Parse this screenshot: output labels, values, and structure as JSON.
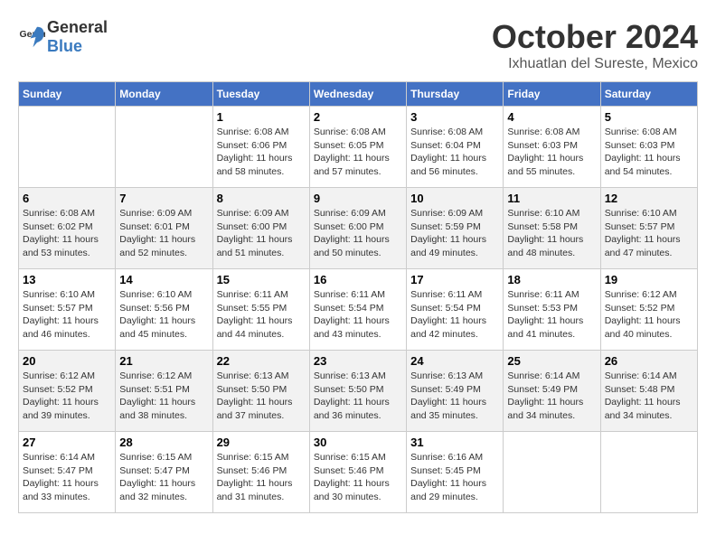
{
  "header": {
    "logo_general": "General",
    "logo_blue": "Blue",
    "month": "October 2024",
    "location": "Ixhuatlan del Sureste, Mexico"
  },
  "days_of_week": [
    "Sunday",
    "Monday",
    "Tuesday",
    "Wednesday",
    "Thursday",
    "Friday",
    "Saturday"
  ],
  "weeks": [
    [
      {
        "day": "",
        "info": ""
      },
      {
        "day": "",
        "info": ""
      },
      {
        "day": "1",
        "sunrise": "6:08 AM",
        "sunset": "6:06 PM",
        "daylight": "11 hours and 58 minutes."
      },
      {
        "day": "2",
        "sunrise": "6:08 AM",
        "sunset": "6:05 PM",
        "daylight": "11 hours and 57 minutes."
      },
      {
        "day": "3",
        "sunrise": "6:08 AM",
        "sunset": "6:04 PM",
        "daylight": "11 hours and 56 minutes."
      },
      {
        "day": "4",
        "sunrise": "6:08 AM",
        "sunset": "6:03 PM",
        "daylight": "11 hours and 55 minutes."
      },
      {
        "day": "5",
        "sunrise": "6:08 AM",
        "sunset": "6:03 PM",
        "daylight": "11 hours and 54 minutes."
      }
    ],
    [
      {
        "day": "6",
        "sunrise": "6:08 AM",
        "sunset": "6:02 PM",
        "daylight": "11 hours and 53 minutes."
      },
      {
        "day": "7",
        "sunrise": "6:09 AM",
        "sunset": "6:01 PM",
        "daylight": "11 hours and 52 minutes."
      },
      {
        "day": "8",
        "sunrise": "6:09 AM",
        "sunset": "6:00 PM",
        "daylight": "11 hours and 51 minutes."
      },
      {
        "day": "9",
        "sunrise": "6:09 AM",
        "sunset": "6:00 PM",
        "daylight": "11 hours and 50 minutes."
      },
      {
        "day": "10",
        "sunrise": "6:09 AM",
        "sunset": "5:59 PM",
        "daylight": "11 hours and 49 minutes."
      },
      {
        "day": "11",
        "sunrise": "6:10 AM",
        "sunset": "5:58 PM",
        "daylight": "11 hours and 48 minutes."
      },
      {
        "day": "12",
        "sunrise": "6:10 AM",
        "sunset": "5:57 PM",
        "daylight": "11 hours and 47 minutes."
      }
    ],
    [
      {
        "day": "13",
        "sunrise": "6:10 AM",
        "sunset": "5:57 PM",
        "daylight": "11 hours and 46 minutes."
      },
      {
        "day": "14",
        "sunrise": "6:10 AM",
        "sunset": "5:56 PM",
        "daylight": "11 hours and 45 minutes."
      },
      {
        "day": "15",
        "sunrise": "6:11 AM",
        "sunset": "5:55 PM",
        "daylight": "11 hours and 44 minutes."
      },
      {
        "day": "16",
        "sunrise": "6:11 AM",
        "sunset": "5:54 PM",
        "daylight": "11 hours and 43 minutes."
      },
      {
        "day": "17",
        "sunrise": "6:11 AM",
        "sunset": "5:54 PM",
        "daylight": "11 hours and 42 minutes."
      },
      {
        "day": "18",
        "sunrise": "6:11 AM",
        "sunset": "5:53 PM",
        "daylight": "11 hours and 41 minutes."
      },
      {
        "day": "19",
        "sunrise": "6:12 AM",
        "sunset": "5:52 PM",
        "daylight": "11 hours and 40 minutes."
      }
    ],
    [
      {
        "day": "20",
        "sunrise": "6:12 AM",
        "sunset": "5:52 PM",
        "daylight": "11 hours and 39 minutes."
      },
      {
        "day": "21",
        "sunrise": "6:12 AM",
        "sunset": "5:51 PM",
        "daylight": "11 hours and 38 minutes."
      },
      {
        "day": "22",
        "sunrise": "6:13 AM",
        "sunset": "5:50 PM",
        "daylight": "11 hours and 37 minutes."
      },
      {
        "day": "23",
        "sunrise": "6:13 AM",
        "sunset": "5:50 PM",
        "daylight": "11 hours and 36 minutes."
      },
      {
        "day": "24",
        "sunrise": "6:13 AM",
        "sunset": "5:49 PM",
        "daylight": "11 hours and 35 minutes."
      },
      {
        "day": "25",
        "sunrise": "6:14 AM",
        "sunset": "5:49 PM",
        "daylight": "11 hours and 34 minutes."
      },
      {
        "day": "26",
        "sunrise": "6:14 AM",
        "sunset": "5:48 PM",
        "daylight": "11 hours and 34 minutes."
      }
    ],
    [
      {
        "day": "27",
        "sunrise": "6:14 AM",
        "sunset": "5:47 PM",
        "daylight": "11 hours and 33 minutes."
      },
      {
        "day": "28",
        "sunrise": "6:15 AM",
        "sunset": "5:47 PM",
        "daylight": "11 hours and 32 minutes."
      },
      {
        "day": "29",
        "sunrise": "6:15 AM",
        "sunset": "5:46 PM",
        "daylight": "11 hours and 31 minutes."
      },
      {
        "day": "30",
        "sunrise": "6:15 AM",
        "sunset": "5:46 PM",
        "daylight": "11 hours and 30 minutes."
      },
      {
        "day": "31",
        "sunrise": "6:16 AM",
        "sunset": "5:45 PM",
        "daylight": "11 hours and 29 minutes."
      },
      {
        "day": "",
        "info": ""
      },
      {
        "day": "",
        "info": ""
      }
    ]
  ]
}
